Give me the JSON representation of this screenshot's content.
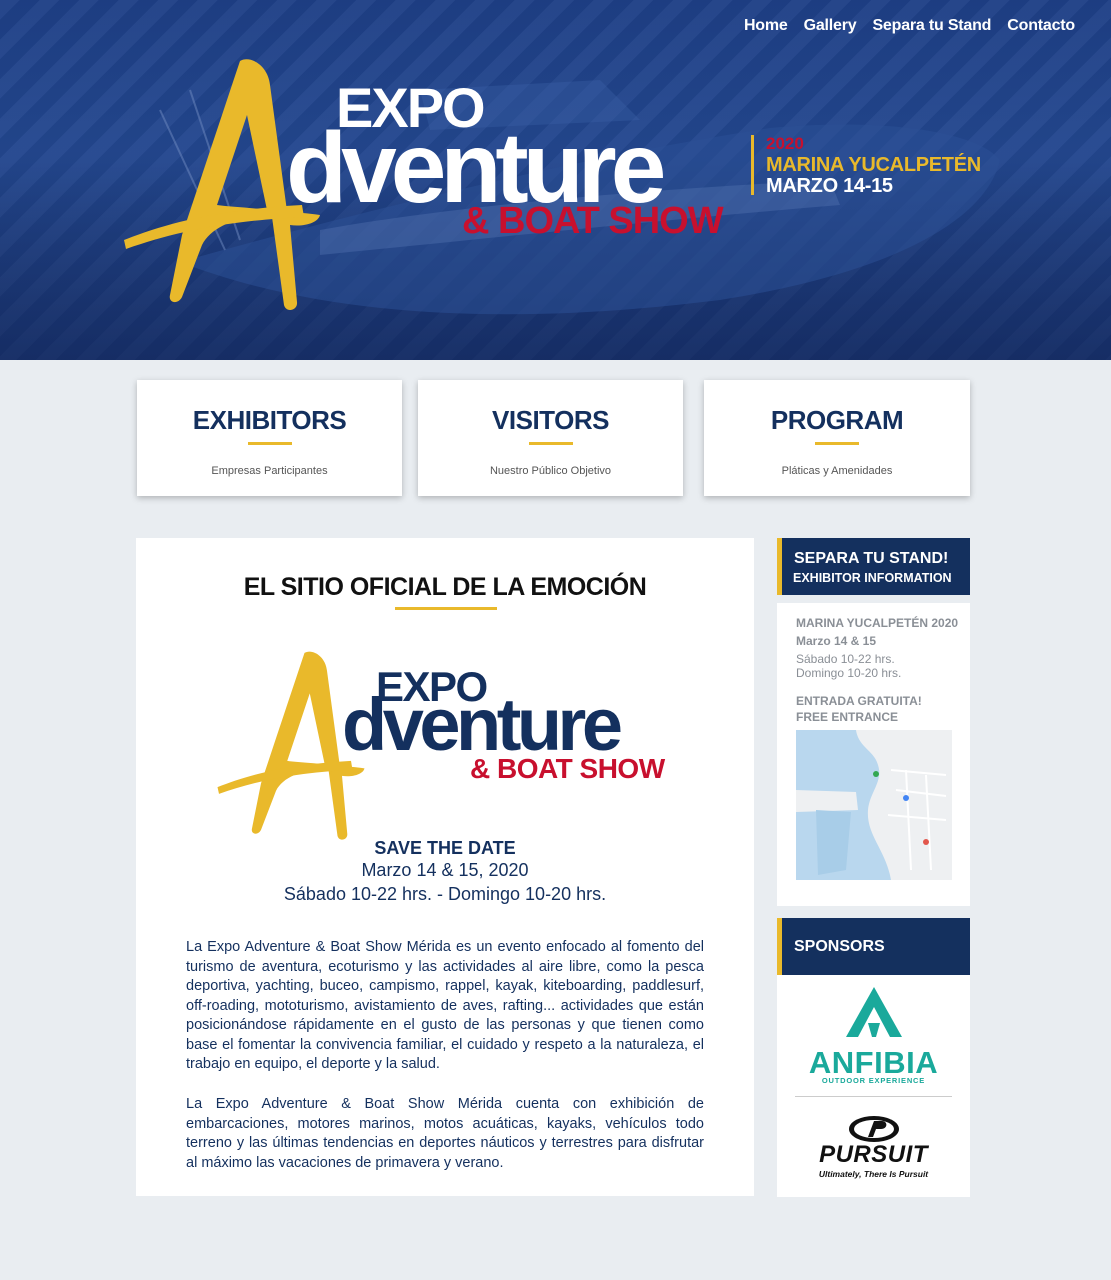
{
  "nav": {
    "home": "Home",
    "gallery": "Gallery",
    "stand": "Separa tu Stand",
    "contact": "Contacto"
  },
  "hero": {
    "expo": "EXPO",
    "adventure": "dventure",
    "boatshow": "& BOAT SHOW",
    "year": "2020",
    "marina": "MARINA YUCALPETÉN",
    "dates": "MARZO 14-15"
  },
  "cards": [
    {
      "title": "EXHIBITORS",
      "subtitle": "Empresas Participantes"
    },
    {
      "title": "VISITORS",
      "subtitle": "Nuestro Público Objetivo"
    },
    {
      "title": "PROGRAM",
      "subtitle": "Pláticas y Amenidades"
    }
  ],
  "main": {
    "title": "EL SITIO OFICIAL DE LA EMOCIÓN",
    "logo_expo": "EXPO",
    "logo_adventure": "dventure",
    "logo_boatshow": "& BOAT SHOW",
    "save_the_date": "SAVE THE DATE",
    "dates": "Marzo 14 & 15, 2020",
    "hours": "Sábado 10-22 hrs. - Domingo 10-20 hrs.",
    "paragraph1": "La Expo Adventure & Boat Show Mérida es un evento enfocado al fomento del turismo de aventura, ecoturismo y las actividades al aire libre, como la pesca deportiva, yachting, buceo, campismo, rappel, kayak, kiteboarding, paddlesurf, off-roading, mototurismo, avistamiento de aves, rafting... actividades que están posicionándose rápidamente en el gusto de las personas y que tienen como base el fomentar la convivencia familiar, el cuidado y respeto a la naturaleza, el trabajo en equipo, el deporte y la salud.",
    "paragraph2": "La Expo Adventure & Boat Show Mérida cuenta con exhibición de embarcaciones, motores marinos, motos acuáticas, kayaks, vehículos todo terreno y las últimas tendencias en deportes náuticos y terrestres para disfrutar al máximo las vacaciones de primavera y verano."
  },
  "sidebar": {
    "stand_title": "SEPARA TU STAND!",
    "stand_subtitle": "EXHIBITOR INFORMATION",
    "venue": "MARINA YUCALPETÉN 2020",
    "dates": "Marzo 14 & 15",
    "saturday": "Sábado 10-22 hrs.",
    "sunday": "Domingo 10-20 hrs.",
    "entrance1": "ENTRADA GRATUITA!",
    "entrance2": "FREE ENTRANCE",
    "sponsors_title": "SPONSORS",
    "sponsor1_name": "ANFIBIA",
    "sponsor1_tagline": "OUTDOOR EXPERIENCE",
    "sponsor2_name": "PURSUIT",
    "sponsor2_tagline": "Ultimately, There Is Pursuit"
  },
  "colors": {
    "navy": "#14305e",
    "gold": "#e9b92b",
    "red": "#c8102e",
    "teal": "#1aa99b"
  }
}
